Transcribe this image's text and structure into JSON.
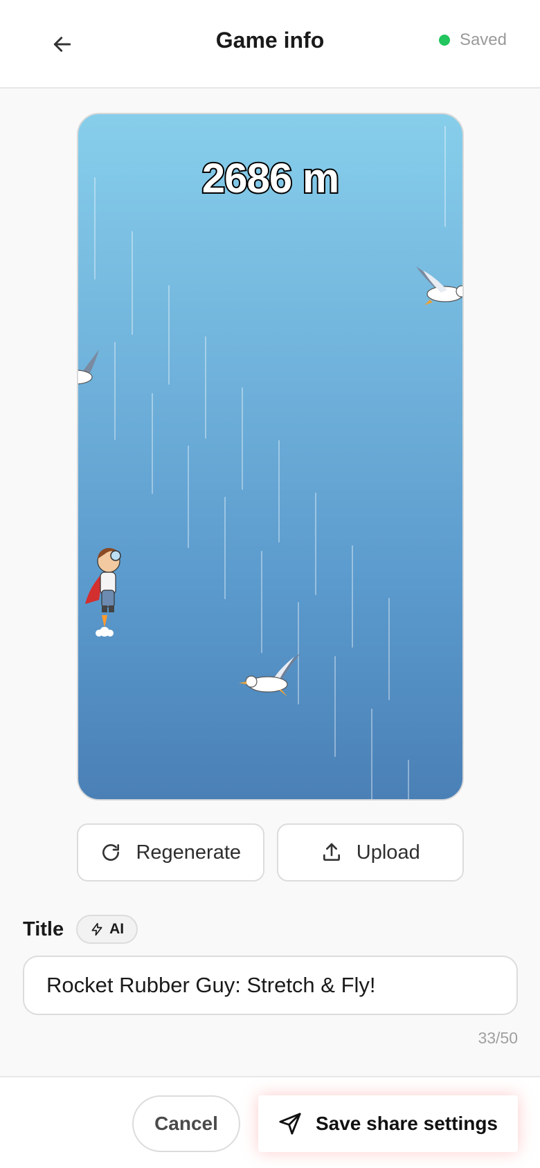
{
  "header": {
    "title": "Game info",
    "back_icon": "arrow-left-icon",
    "status_text": "Saved",
    "status_color": "#22c55e"
  },
  "preview": {
    "score_text": "2686 m",
    "sky_colors": [
      "#87ceeb",
      "#4a80b6"
    ]
  },
  "actions": {
    "regenerate_label": "Regenerate",
    "upload_label": "Upload"
  },
  "title_field": {
    "label": "Title",
    "ai_badge": "AI",
    "value": "Rocket Rubber Guy: Stretch & Fly!",
    "counter": "33/50"
  },
  "footer": {
    "cancel_label": "Cancel",
    "save_label": "Save share settings"
  }
}
